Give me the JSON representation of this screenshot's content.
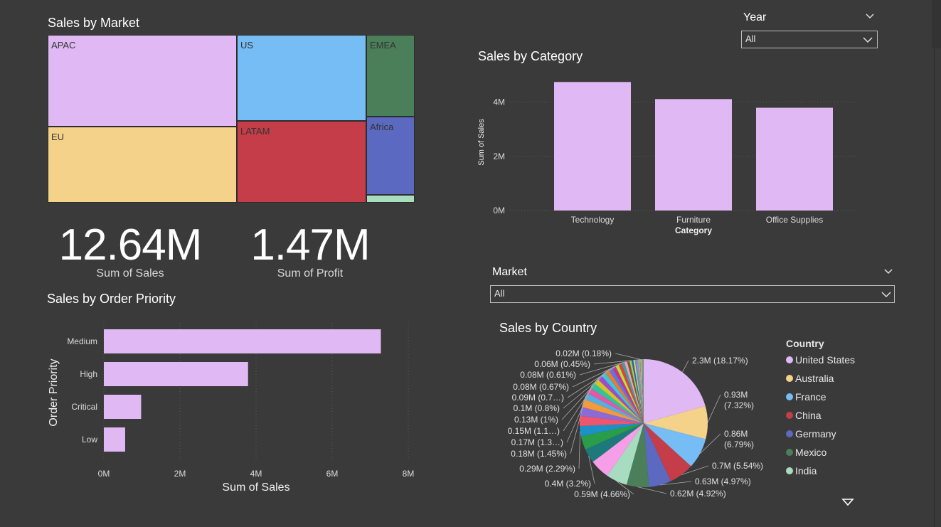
{
  "colors": {
    "background": "#3a3a3a",
    "bar": "#e0b8f4",
    "grid": "#5a5a5a",
    "axis_text": "#dcdcdc"
  },
  "market_chart": {
    "title": "Sales by Market",
    "chart_data": {
      "type": "treemap",
      "items": [
        {
          "label": "APAC",
          "color": "#e0b8f4"
        },
        {
          "label": "EU",
          "color": "#f5d28a"
        },
        {
          "label": "US",
          "color": "#76bcf5"
        },
        {
          "label": "LATAM",
          "color": "#c43d48"
        },
        {
          "label": "EMEA",
          "color": "#4a7f5a"
        },
        {
          "label": "Africa",
          "color": "#5b69c0"
        },
        {
          "label": "",
          "color": "#a8dcc0"
        }
      ]
    }
  },
  "kpis": [
    {
      "value": "12.64M",
      "label": "Sum of Sales"
    },
    {
      "value": "1.47M",
      "label": "Sum of Profit"
    }
  ],
  "year_slicer": {
    "label": "Year",
    "value": "All"
  },
  "market_slicer": {
    "label": "Market",
    "value": "All"
  },
  "category_chart": {
    "title": "Sales by Category",
    "chart_data": {
      "type": "bar",
      "categories": [
        "Technology",
        "Furniture",
        "Office Supplies"
      ],
      "values": [
        4.74,
        4.11,
        3.79
      ],
      "xlabel": "Category",
      "ylabel": "Sum of Sales",
      "ylim": [
        0,
        4.8
      ],
      "yticks": [
        {
          "v": 0,
          "label": "0M"
        },
        {
          "v": 2,
          "label": "2M"
        },
        {
          "v": 4,
          "label": "4M"
        }
      ]
    }
  },
  "priority_chart": {
    "title": "Sales by Order Priority",
    "chart_data": {
      "type": "bar",
      "orientation": "horizontal",
      "categories": [
        "Medium",
        "High",
        "Critical",
        "Low"
      ],
      "values": [
        7.28,
        3.79,
        0.98,
        0.56
      ],
      "xlabel": "Sum of Sales",
      "ylabel": "Order Priority",
      "xlim": [
        0,
        8
      ],
      "xticks": [
        {
          "v": 0,
          "label": "0M"
        },
        {
          "v": 2,
          "label": "2M"
        },
        {
          "v": 4,
          "label": "4M"
        },
        {
          "v": 6,
          "label": "6M"
        },
        {
          "v": 8,
          "label": "8M"
        }
      ]
    }
  },
  "country_chart": {
    "title": "Sales by Country",
    "legend_title": "Country",
    "chart_data": {
      "type": "pie",
      "slices": [
        {
          "name": "United States",
          "value": 18.17,
          "color": "#e0b8f4",
          "label": "2.3M (18.17%)"
        },
        {
          "name": "Australia",
          "value": 7.32,
          "color": "#f5d28a",
          "label": "0.93M\n(7.32%)"
        },
        {
          "name": "France",
          "value": 6.79,
          "color": "#76bcf5",
          "label": "0.86M\n(6.79%)"
        },
        {
          "name": "China",
          "value": 5.54,
          "color": "#c43d48",
          "label": "0.7M (5.54%)"
        },
        {
          "name": "Germany",
          "value": 4.97,
          "color": "#5b69c0",
          "label": "0.63M (4.97%)"
        },
        {
          "name": "Mexico",
          "value": 4.92,
          "color": "#4a7f5a",
          "label": "0.62M (4.92%)"
        },
        {
          "name": "India",
          "value": 4.66,
          "color": "#a8dcc0",
          "label": "0.59M (4.66%)"
        },
        {
          "value": 4.4,
          "color": "#f79ee8",
          "label": ""
        },
        {
          "value": 3.2,
          "color": "#1e7a7a",
          "label": "0.4M (3.2%)"
        },
        {
          "value": 3.0,
          "color": "#2a9d4a",
          "label": ""
        },
        {
          "value": 2.29,
          "color": "#1e90c8",
          "label": "0.29M (2.29%)"
        },
        {
          "value": 2.2,
          "color": "#f0556e",
          "label": ""
        },
        {
          "value": 2.0,
          "color": "#8c6bd6",
          "label": ""
        },
        {
          "value": 1.8,
          "color": "#f59a3a",
          "label": ""
        },
        {
          "value": 1.45,
          "color": "#55b0e0",
          "label": "0.18M (1.45%)"
        },
        {
          "value": 1.35,
          "color": "#e05aa8",
          "label": ""
        },
        {
          "value": 1.3,
          "color": "#2ec4a0",
          "label": "0.17M (1.3…)"
        },
        {
          "value": 1.2,
          "color": "#d4c42a",
          "label": ""
        },
        {
          "value": 1.1,
          "color": "#a04ad0",
          "label": "0.15M (1.1…)"
        },
        {
          "value": 1.05,
          "color": "#3ac8d8",
          "label": ""
        },
        {
          "value": 1.0,
          "color": "#e87a3a",
          "label": "0.13M (1%)"
        },
        {
          "value": 0.9,
          "color": "#5a7ae0",
          "label": ""
        },
        {
          "value": 0.8,
          "color": "#d0308a",
          "label": "0.1M (0.8%)"
        },
        {
          "value": 0.75,
          "color": "#b8e040",
          "label": ""
        },
        {
          "value": 0.7,
          "color": "#e04040",
          "label": "0.09M (0.7…)"
        },
        {
          "value": 0.67,
          "color": "#40a0a0",
          "label": "0.08M (0.67%)"
        },
        {
          "value": 0.61,
          "color": "#f0a0c0",
          "label": "0.08M (0.61%)"
        },
        {
          "value": 0.55,
          "color": "#7a5a2a",
          "label": ""
        },
        {
          "value": 0.45,
          "color": "#9ad060",
          "label": "0.06M (0.45%)"
        },
        {
          "value": 0.4,
          "color": "#3a5ac0",
          "label": ""
        },
        {
          "value": 0.35,
          "color": "#e0d060",
          "label": ""
        },
        {
          "value": 0.3,
          "color": "#20b0e0",
          "label": ""
        },
        {
          "value": 0.28,
          "color": "#f070a0",
          "label": ""
        },
        {
          "value": 0.25,
          "color": "#60c080",
          "label": ""
        },
        {
          "value": 0.22,
          "color": "#c0a0f0",
          "label": ""
        },
        {
          "value": 0.18,
          "color": "#a0a040",
          "label": "0.02M (0.18%)"
        },
        {
          "value": 0.16,
          "color": "#f0c060",
          "label": ""
        },
        {
          "value": 0.14,
          "color": "#80e0e0",
          "label": ""
        },
        {
          "value": 0.12,
          "color": "#4060a0",
          "label": ""
        },
        {
          "value": 0.1,
          "color": "#d0d0a0",
          "label": ""
        },
        {
          "value": 0.08,
          "color": "#909090",
          "label": ""
        },
        {
          "value": 0.06,
          "color": "#b0b060",
          "label": ""
        },
        {
          "value": 0.05,
          "color": "#60a0d0",
          "label": ""
        }
      ]
    }
  }
}
